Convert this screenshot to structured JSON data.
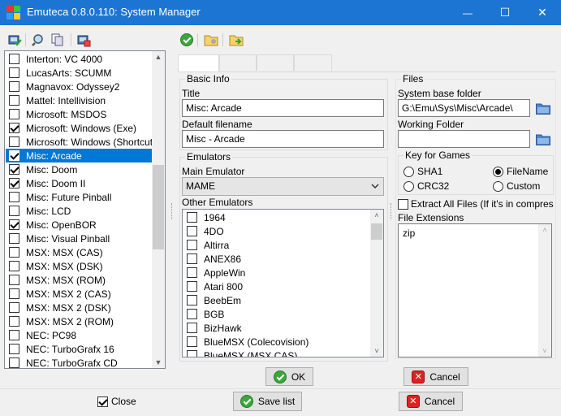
{
  "window": {
    "title": "Emuteca 0.8.0.110: System Manager",
    "minimize": "—",
    "maximize": "☐",
    "close": "✕"
  },
  "systems": [
    {
      "label": "Interton: VC 4000",
      "checked": false
    },
    {
      "label": "LucasArts: SCUMM",
      "checked": false
    },
    {
      "label": "Magnavox: Odyssey2",
      "checked": false
    },
    {
      "label": "Mattel: Intellivision",
      "checked": false
    },
    {
      "label": "Microsoft: MSDOS",
      "checked": false
    },
    {
      "label": "Microsoft: Windows (Exe)",
      "checked": true
    },
    {
      "label": "Microsoft: Windows (Shortcut)",
      "checked": false
    },
    {
      "label": "Misc: Arcade",
      "checked": true,
      "selected": true
    },
    {
      "label": "Misc: Doom",
      "checked": true
    },
    {
      "label": "Misc: Doom II",
      "checked": true
    },
    {
      "label": "Misc: Future Pinball",
      "checked": false
    },
    {
      "label": "Misc: LCD",
      "checked": false
    },
    {
      "label": "Misc: OpenBOR",
      "checked": true
    },
    {
      "label": "Misc: Visual Pinball",
      "checked": false
    },
    {
      "label": "MSX: MSX (CAS)",
      "checked": false
    },
    {
      "label": "MSX: MSX (DSK)",
      "checked": false
    },
    {
      "label": "MSX: MSX (ROM)",
      "checked": false
    },
    {
      "label": "MSX: MSX 2 (CAS)",
      "checked": false
    },
    {
      "label": "MSX: MSX 2 (DSK)",
      "checked": false
    },
    {
      "label": "MSX: MSX 2 (ROM)",
      "checked": false
    },
    {
      "label": "NEC: PC98",
      "checked": false
    },
    {
      "label": "NEC: TurboGrafx 16",
      "checked": false
    },
    {
      "label": "NEC: TurboGrafx CD",
      "checked": false
    }
  ],
  "basic_info": {
    "group_label": "Basic Info",
    "title_label": "Title",
    "title_value": "Misc: Arcade",
    "filename_label": "Default filename",
    "filename_value": "Misc - Arcade"
  },
  "emulators": {
    "group_label": "Emulators",
    "main_label": "Main Emulator",
    "main_value": "MAME",
    "other_label": "Other Emulators",
    "list": [
      "1964",
      "4DO",
      "Altirra",
      "ANEX86",
      "AppleWin",
      "Atari 800",
      "BeebEm",
      "BGB",
      "BizHawk",
      "BlueMSX (Colecovision)",
      "BlueMSX (MSX CAS)"
    ]
  },
  "files": {
    "group_label": "Files",
    "base_folder_label": "System base folder",
    "base_folder_value": "G:\\Emu\\Sys\\Misc\\Arcade\\",
    "working_folder_label": "Working Folder",
    "working_folder_value": "",
    "key_label": "Key for Games",
    "radio_sha1": "SHA1",
    "radio_filename": "FileName",
    "radio_crc32": "CRC32",
    "radio_custom": "Custom",
    "selected_key": "FileName",
    "extract_label": "Extract All Files (If it's in compressed",
    "extensions_label": "File Extensions",
    "extensions_value": "zip"
  },
  "buttons": {
    "ok": "OK",
    "cancel_inner": "Cancel",
    "close_label": "Close",
    "save_list": "Save list",
    "cancel_outer": "Cancel"
  }
}
